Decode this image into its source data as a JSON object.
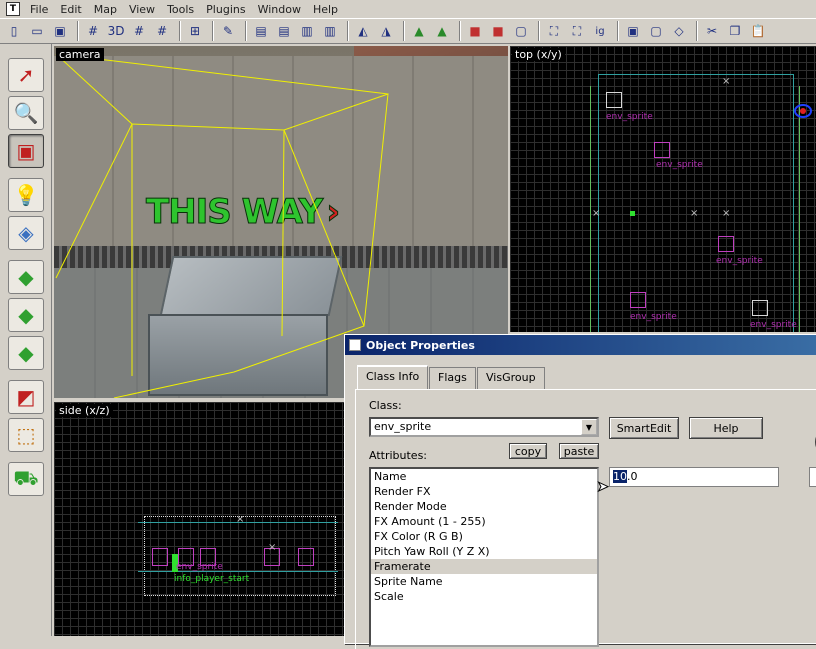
{
  "menubar": {
    "items": [
      "File",
      "Edit",
      "Map",
      "View",
      "Tools",
      "Plugins",
      "Window",
      "Help"
    ]
  },
  "viewports": {
    "camera": {
      "label": "camera",
      "sign_text": "THIS WAY"
    },
    "top": {
      "label": "top (x/y)",
      "entities": [
        "env_sprite",
        "env_sprite",
        "env_sprite",
        "env_sprite",
        "env_sprite"
      ]
    },
    "side": {
      "label": "side (x/z)",
      "entities": [
        "info_player_start",
        "env_sprite"
      ]
    }
  },
  "dialog": {
    "title": "Object Properties",
    "tabs": [
      "Class Info",
      "Flags",
      "VisGroup"
    ],
    "class_label": "Class:",
    "class_value": "env_sprite",
    "attributes_label": "Attributes:",
    "buttons": {
      "smartedit": "SmartEdit",
      "help": "Help",
      "copy": "copy",
      "paste": "paste"
    },
    "attributes": [
      "Name",
      "Render FX",
      "Render Mode",
      "FX Amount (1 - 255)",
      "FX Color (R G B)",
      "Pitch Yaw Roll (Y Z X)",
      "Framerate",
      "Sprite Name",
      "Scale"
    ],
    "selected_attribute": "Framerate",
    "value_highlight": "10",
    "value_rest": ".0"
  },
  "icons": [
    "app-icon",
    "select-tool-icon",
    "magnify-tool-icon",
    "camera-tool-icon",
    "entity-tool-icon",
    "block-tool-icon",
    "texture-tool-icon",
    "apply-texture-icon",
    "decal-tool-icon",
    "clipping-tool-icon",
    "vertex-tool-icon",
    "path-tool-icon"
  ]
}
